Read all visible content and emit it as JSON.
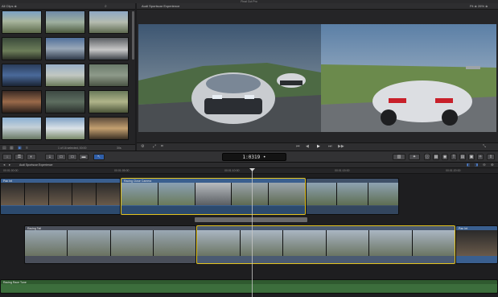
{
  "window": {
    "title": "Final Cut Pro"
  },
  "browser": {
    "header_label": "All Clips ≑",
    "selection_text": "1 of 16 selected, 00:00",
    "duration_text": "30s",
    "clip_count": 15
  },
  "viewer": {
    "title": "Audi Sportscar Experience",
    "fit_label": "Fit ≑  26% ≑"
  },
  "toolbar": {
    "timecode": "1:0319",
    "timecode_suffix": "•"
  },
  "timeline": {
    "project_title": "Audi Sportscar Experience",
    "ruler_ticks": [
      "00:01:00:00",
      "00:01:05:00",
      "00:01:10:00",
      "00:01:15:00",
      "00:01:20:00",
      "00:01:25:00"
    ],
    "clips": {
      "interview_1": "Pan Int",
      "racing_close": "Racing Close Camera",
      "racing_tail": "Racing Tail",
      "interview_2": "Pan Int",
      "audio": "Racing Race Tune"
    }
  },
  "colors": {
    "accent_blue": "#2f5ea8",
    "clip_blue": "#3a5f8f",
    "clip_grey": "#4a4f5a",
    "audio_green": "#3c6e3c",
    "selection_yellow": "#e3c21e"
  }
}
